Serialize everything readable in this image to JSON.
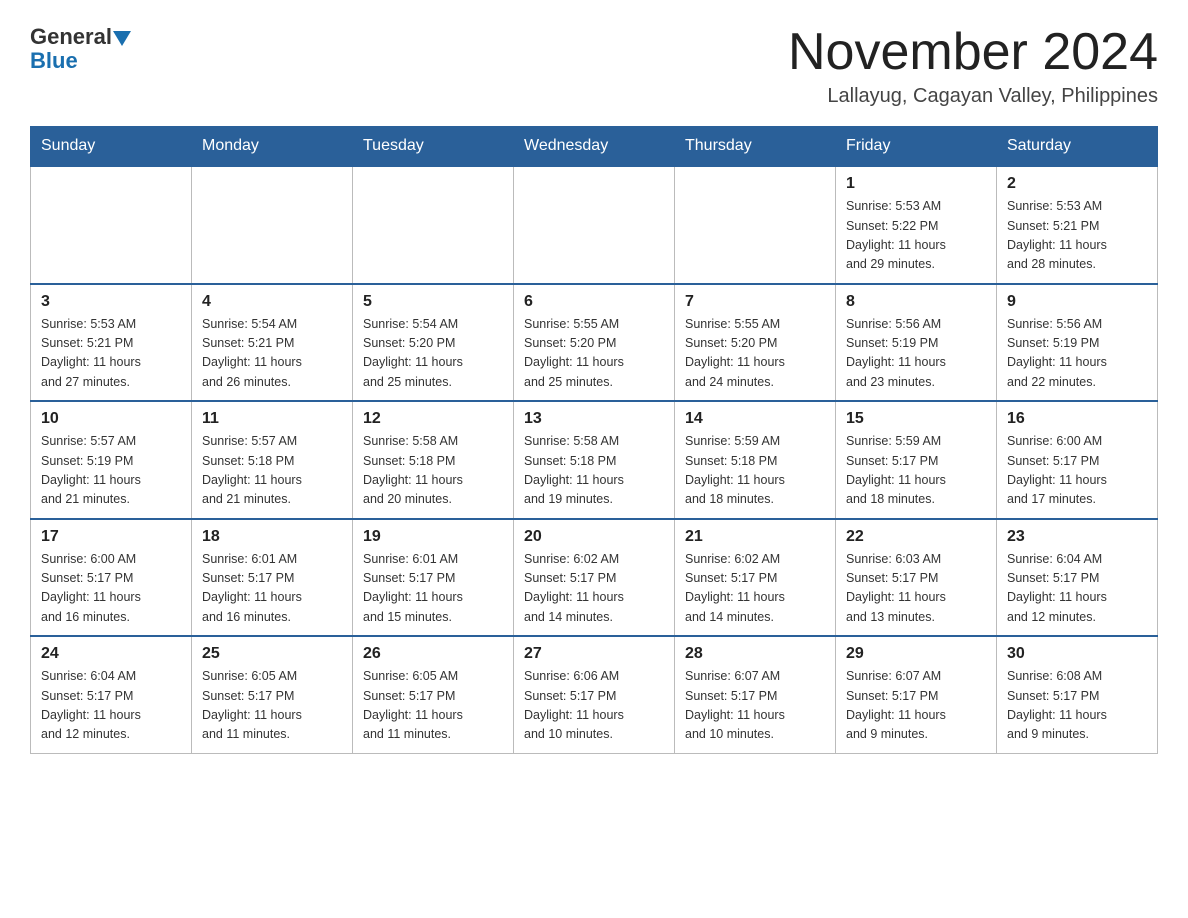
{
  "header": {
    "logo_general": "General",
    "logo_blue": "Blue",
    "month_year": "November 2024",
    "location": "Lallayug, Cagayan Valley, Philippines"
  },
  "weekdays": [
    "Sunday",
    "Monday",
    "Tuesday",
    "Wednesday",
    "Thursday",
    "Friday",
    "Saturday"
  ],
  "weeks": [
    [
      {
        "day": "",
        "info": ""
      },
      {
        "day": "",
        "info": ""
      },
      {
        "day": "",
        "info": ""
      },
      {
        "day": "",
        "info": ""
      },
      {
        "day": "",
        "info": ""
      },
      {
        "day": "1",
        "info": "Sunrise: 5:53 AM\nSunset: 5:22 PM\nDaylight: 11 hours\nand 29 minutes."
      },
      {
        "day": "2",
        "info": "Sunrise: 5:53 AM\nSunset: 5:21 PM\nDaylight: 11 hours\nand 28 minutes."
      }
    ],
    [
      {
        "day": "3",
        "info": "Sunrise: 5:53 AM\nSunset: 5:21 PM\nDaylight: 11 hours\nand 27 minutes."
      },
      {
        "day": "4",
        "info": "Sunrise: 5:54 AM\nSunset: 5:21 PM\nDaylight: 11 hours\nand 26 minutes."
      },
      {
        "day": "5",
        "info": "Sunrise: 5:54 AM\nSunset: 5:20 PM\nDaylight: 11 hours\nand 25 minutes."
      },
      {
        "day": "6",
        "info": "Sunrise: 5:55 AM\nSunset: 5:20 PM\nDaylight: 11 hours\nand 25 minutes."
      },
      {
        "day": "7",
        "info": "Sunrise: 5:55 AM\nSunset: 5:20 PM\nDaylight: 11 hours\nand 24 minutes."
      },
      {
        "day": "8",
        "info": "Sunrise: 5:56 AM\nSunset: 5:19 PM\nDaylight: 11 hours\nand 23 minutes."
      },
      {
        "day": "9",
        "info": "Sunrise: 5:56 AM\nSunset: 5:19 PM\nDaylight: 11 hours\nand 22 minutes."
      }
    ],
    [
      {
        "day": "10",
        "info": "Sunrise: 5:57 AM\nSunset: 5:19 PM\nDaylight: 11 hours\nand 21 minutes."
      },
      {
        "day": "11",
        "info": "Sunrise: 5:57 AM\nSunset: 5:18 PM\nDaylight: 11 hours\nand 21 minutes."
      },
      {
        "day": "12",
        "info": "Sunrise: 5:58 AM\nSunset: 5:18 PM\nDaylight: 11 hours\nand 20 minutes."
      },
      {
        "day": "13",
        "info": "Sunrise: 5:58 AM\nSunset: 5:18 PM\nDaylight: 11 hours\nand 19 minutes."
      },
      {
        "day": "14",
        "info": "Sunrise: 5:59 AM\nSunset: 5:18 PM\nDaylight: 11 hours\nand 18 minutes."
      },
      {
        "day": "15",
        "info": "Sunrise: 5:59 AM\nSunset: 5:17 PM\nDaylight: 11 hours\nand 18 minutes."
      },
      {
        "day": "16",
        "info": "Sunrise: 6:00 AM\nSunset: 5:17 PM\nDaylight: 11 hours\nand 17 minutes."
      }
    ],
    [
      {
        "day": "17",
        "info": "Sunrise: 6:00 AM\nSunset: 5:17 PM\nDaylight: 11 hours\nand 16 minutes."
      },
      {
        "day": "18",
        "info": "Sunrise: 6:01 AM\nSunset: 5:17 PM\nDaylight: 11 hours\nand 16 minutes."
      },
      {
        "day": "19",
        "info": "Sunrise: 6:01 AM\nSunset: 5:17 PM\nDaylight: 11 hours\nand 15 minutes."
      },
      {
        "day": "20",
        "info": "Sunrise: 6:02 AM\nSunset: 5:17 PM\nDaylight: 11 hours\nand 14 minutes."
      },
      {
        "day": "21",
        "info": "Sunrise: 6:02 AM\nSunset: 5:17 PM\nDaylight: 11 hours\nand 14 minutes."
      },
      {
        "day": "22",
        "info": "Sunrise: 6:03 AM\nSunset: 5:17 PM\nDaylight: 11 hours\nand 13 minutes."
      },
      {
        "day": "23",
        "info": "Sunrise: 6:04 AM\nSunset: 5:17 PM\nDaylight: 11 hours\nand 12 minutes."
      }
    ],
    [
      {
        "day": "24",
        "info": "Sunrise: 6:04 AM\nSunset: 5:17 PM\nDaylight: 11 hours\nand 12 minutes."
      },
      {
        "day": "25",
        "info": "Sunrise: 6:05 AM\nSunset: 5:17 PM\nDaylight: 11 hours\nand 11 minutes."
      },
      {
        "day": "26",
        "info": "Sunrise: 6:05 AM\nSunset: 5:17 PM\nDaylight: 11 hours\nand 11 minutes."
      },
      {
        "day": "27",
        "info": "Sunrise: 6:06 AM\nSunset: 5:17 PM\nDaylight: 11 hours\nand 10 minutes."
      },
      {
        "day": "28",
        "info": "Sunrise: 6:07 AM\nSunset: 5:17 PM\nDaylight: 11 hours\nand 10 minutes."
      },
      {
        "day": "29",
        "info": "Sunrise: 6:07 AM\nSunset: 5:17 PM\nDaylight: 11 hours\nand 9 minutes."
      },
      {
        "day": "30",
        "info": "Sunrise: 6:08 AM\nSunset: 5:17 PM\nDaylight: 11 hours\nand 9 minutes."
      }
    ]
  ]
}
